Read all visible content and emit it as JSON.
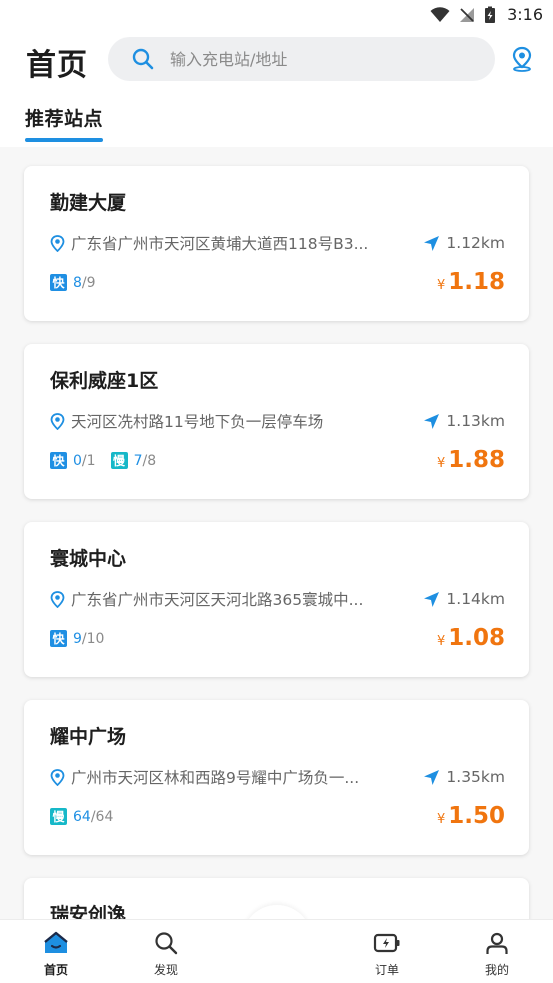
{
  "status_bar": {
    "time": "3:16"
  },
  "header": {
    "title": "首页",
    "search_placeholder": "输入充电站/地址",
    "section_tab": "推荐站点"
  },
  "colors": {
    "accent": "#1e8fe1",
    "price": "#f0750f",
    "fast_badge": "#1f8fe3",
    "slow_badge": "#16b8c8"
  },
  "stations": [
    {
      "name": "勤建大厦",
      "address": "广东省广州市天河区黄埔大道西118号B3...",
      "distance": "1.12km",
      "fast": {
        "label": "快",
        "available": "8",
        "total": "9"
      },
      "currency": "¥",
      "price": "1.18"
    },
    {
      "name": "保利威座1区",
      "address": "天河区冼村路11号地下负一层停车场",
      "distance": "1.13km",
      "fast": {
        "label": "快",
        "available": "0",
        "total": "1"
      },
      "slow": {
        "label": "慢",
        "available": "7",
        "total": "8"
      },
      "currency": "¥",
      "price": "1.88"
    },
    {
      "name": "寰城中心",
      "address": "广东省广州市天河区天河北路365寰城中...",
      "distance": "1.14km",
      "fast": {
        "label": "快",
        "available": "9",
        "total": "10"
      },
      "currency": "¥",
      "price": "1.08"
    },
    {
      "name": "耀中广场",
      "address": "广州市天河区林和西路9号耀中广场负一...",
      "distance": "1.35km",
      "slow": {
        "label": "慢",
        "available": "64",
        "total": "64"
      },
      "currency": "¥",
      "price": "1.50"
    },
    {
      "name": "瑞安创逸"
    }
  ],
  "nav": {
    "home": "首页",
    "discover": "发现",
    "orders": "订单",
    "mine": "我的"
  },
  "icons": {
    "search": "search-icon",
    "location": "location-pin-icon",
    "address_pin": "map-pin-icon",
    "distance": "navigation-arrow-icon",
    "scan": "scan-icon"
  }
}
